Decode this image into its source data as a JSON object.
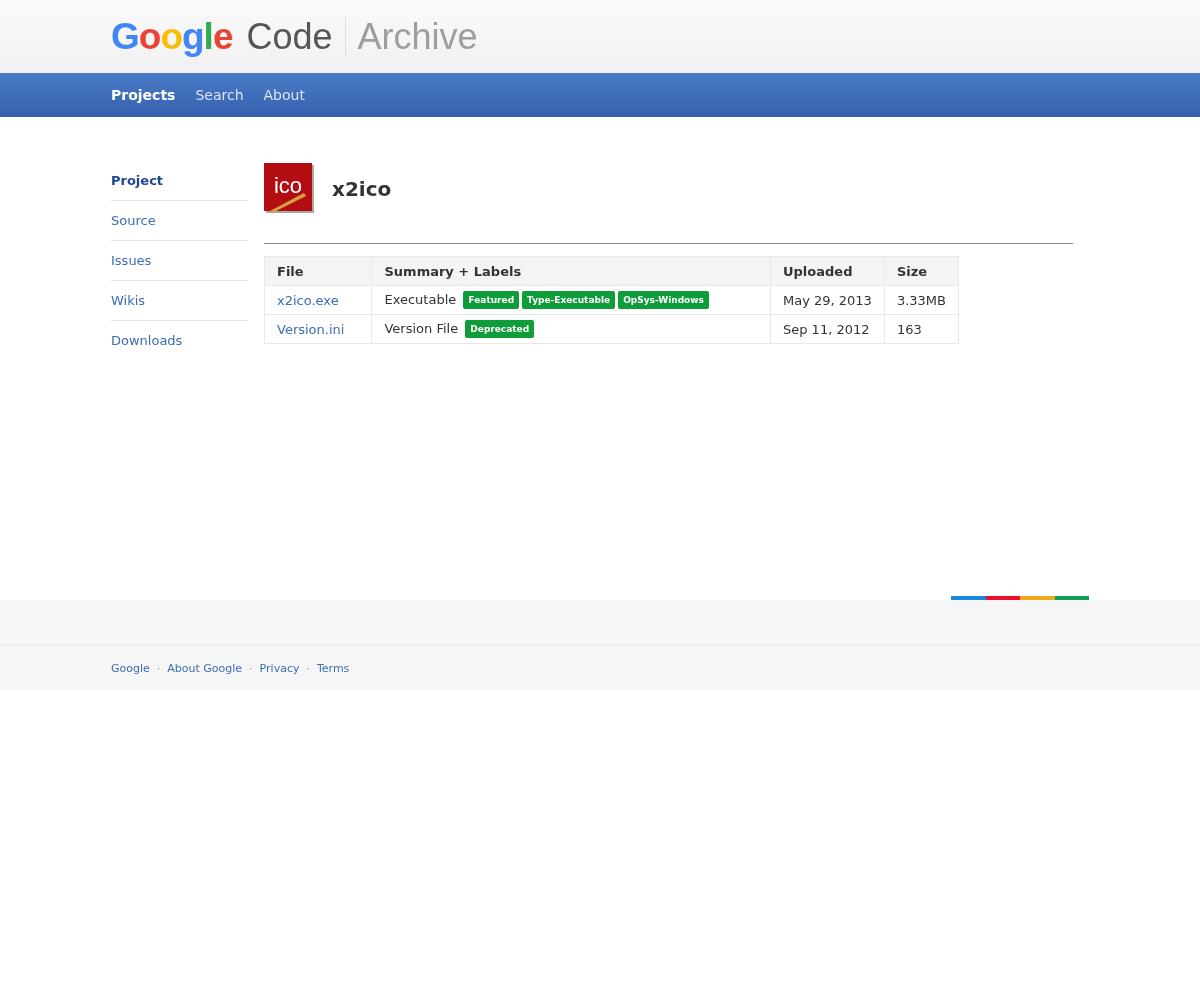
{
  "header": {
    "logo_word": "Google",
    "product": "Code",
    "section": "Archive"
  },
  "nav": [
    {
      "label": "Projects",
      "selected": true
    },
    {
      "label": "Search",
      "selected": false
    },
    {
      "label": "About",
      "selected": false
    }
  ],
  "sidebar": {
    "items": [
      {
        "label": "Project",
        "selected": true
      },
      {
        "label": "Source",
        "selected": false
      },
      {
        "label": "Issues",
        "selected": false
      },
      {
        "label": "Wikis",
        "selected": false
      },
      {
        "label": "Downloads",
        "selected": false
      }
    ]
  },
  "project": {
    "name": "x2ico",
    "icon_text": "ico"
  },
  "table": {
    "columns": [
      "File",
      "Summary + Labels",
      "Uploaded",
      "Size"
    ],
    "rows": [
      {
        "file": "x2ico.exe",
        "summary": "Executable",
        "labels": [
          "Featured",
          "Type-Executable",
          "OpSys-Windows"
        ],
        "uploaded": "May 29, 2013",
        "size": "3.33MB"
      },
      {
        "file": "Version.ini",
        "summary": "Version File",
        "labels": [
          "Deprecated"
        ],
        "uploaded": "Sep 11, 2012",
        "size": "163"
      }
    ]
  },
  "footer": {
    "links": [
      "Google",
      "About Google",
      "Privacy",
      "Terms"
    ],
    "separator": "·"
  }
}
